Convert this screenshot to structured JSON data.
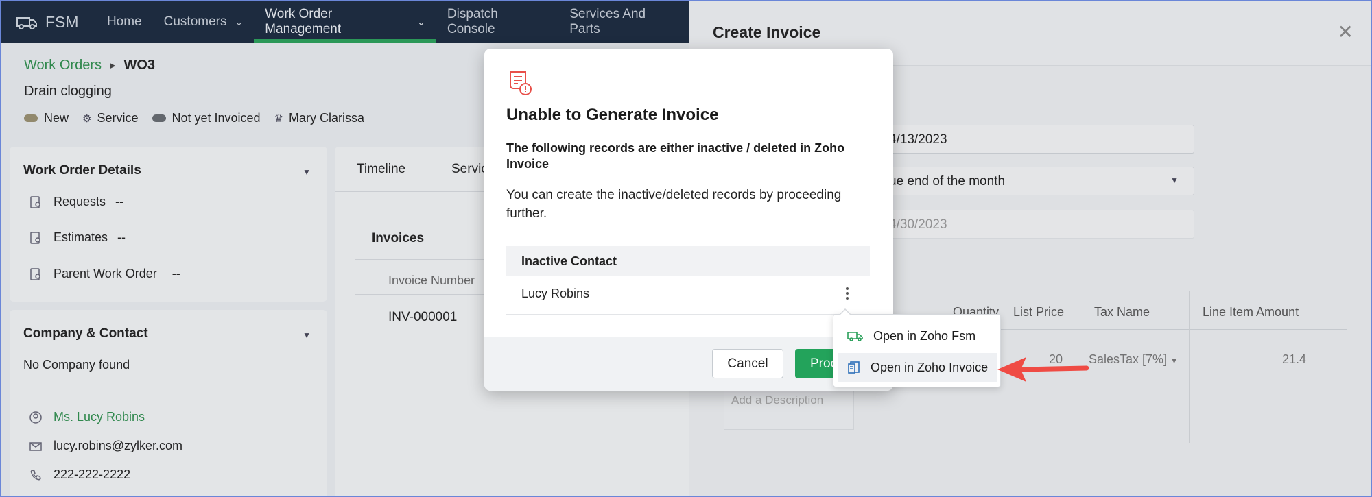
{
  "nav": {
    "brand": "FSM",
    "items": [
      {
        "label": "Home",
        "dropdown": false,
        "active": false
      },
      {
        "label": "Customers",
        "dropdown": true,
        "active": false
      },
      {
        "label": "Work Order Management",
        "dropdown": true,
        "active": true
      },
      {
        "label": "Dispatch Console",
        "dropdown": false,
        "active": false
      },
      {
        "label": "Services And Parts",
        "dropdown": false,
        "active": false
      }
    ]
  },
  "breadcrumb": {
    "parent": "Work Orders",
    "current": "WO3"
  },
  "work_order": {
    "summary": "Drain clogging",
    "tags": {
      "status": "New",
      "type": "Service",
      "invoice_status": "Not yet Invoiced",
      "owner": "Mary Clarissa"
    }
  },
  "details_panel": {
    "title": "Work Order Details",
    "rows": [
      {
        "label": "Requests",
        "value": "--"
      },
      {
        "label": "Estimates",
        "value": "--"
      },
      {
        "label": "Parent Work Order",
        "value": "--"
      }
    ]
  },
  "company_panel": {
    "title": "Company & Contact",
    "no_company": "No Company found",
    "contact_name": "Ms. Lucy Robins",
    "email": "lucy.robins@zylker.com",
    "phone": "222-222-2222"
  },
  "center_panel": {
    "tabs": [
      "Timeline",
      "Servic"
    ],
    "invoices_title": "Invoices",
    "table_header": "Invoice Number",
    "rows": [
      "INV-000001"
    ]
  },
  "drawer": {
    "title": "Create Invoice",
    "invoice_date": "4/13/2023",
    "terms": "ue end of the month",
    "due_date": "4/30/2023",
    "table_headers": [
      "Quantity",
      "List Price",
      "Tax Name",
      "Line Item Amount"
    ],
    "line_item": {
      "list_price": "20",
      "tax_name": "SalesTax [7%]",
      "amount": "21.4"
    },
    "description_placeholder": "Add a Description"
  },
  "modal": {
    "title": "Unable to Generate Invoice",
    "subtitle": "The following records are either inactive / deleted in Zoho Invoice",
    "body": "You can create the inactive/deleted records by proceeding further.",
    "table_header": "Inactive Contact",
    "row": "Lucy Robins",
    "cancel_label": "Cancel",
    "proceed_label": "Proceed"
  },
  "context_menu": {
    "items": [
      {
        "label": "Open in Zoho Fsm"
      },
      {
        "label": "Open in Zoho Invoice"
      }
    ]
  },
  "colors": {
    "nav_bg": "#1b2a3e",
    "accent_green": "#23a35b",
    "link_green": "#2f8f4e",
    "annotation_arrow": "#ef4b44",
    "status_new_pill": "#9a9070"
  }
}
